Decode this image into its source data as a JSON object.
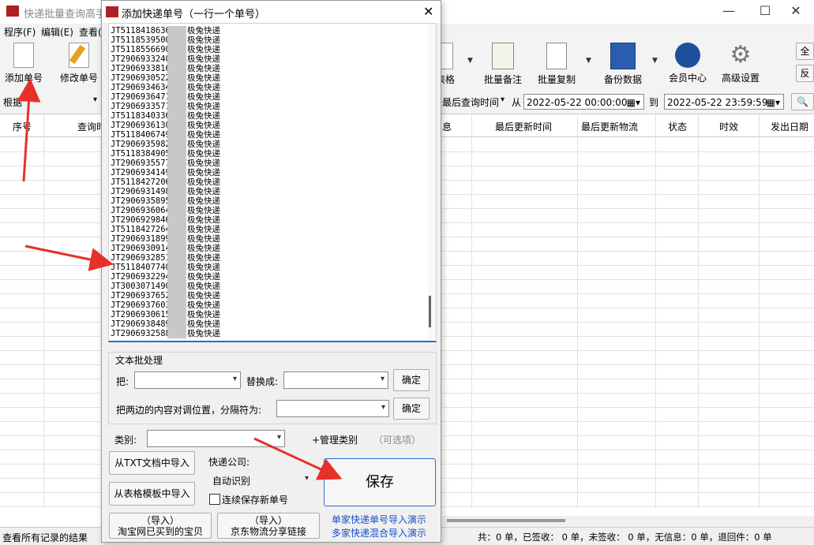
{
  "main": {
    "title": "快递批量查询高手",
    "menu": [
      "程序(F)",
      "编辑(E)",
      "查看("
    ],
    "toolbar_left": {
      "add": "添加单号",
      "edit": "修改单号"
    },
    "toolbar_right": {
      "table": "表格",
      "batch_note": "批量备注",
      "batch_copy": "批量复制",
      "backup": "备份数据",
      "member": "会员中心",
      "advanced": "高级设置",
      "select_all": "全选",
      "invert": "反选"
    },
    "filter": {
      "basis": "根据",
      "field": "最后查询时间",
      "from": "从",
      "start": "2022-05-22 00:00:00",
      "to": "到",
      "end": "2022-05-22 23:59:59"
    },
    "columns": [
      "序号",
      "查询时",
      "息",
      "最后更新时间",
      "最后更新物流",
      "状态",
      "时效",
      "发出日期"
    ],
    "status_left": "查看所有记录的结果",
    "status_right": "共：0 单，已签收： 0 单，未签收： 0 单，无信息：0 单，退回件：0 单"
  },
  "dialog": {
    "title": "添加快递单号（一行一个单号）",
    "close": "✕",
    "rows": [
      {
        "num": "JT51184186368",
        "carrier": "极兔快递"
      },
      {
        "num": "JT51185395000",
        "carrier": "极兔快递"
      },
      {
        "num": "JT51185566900",
        "carrier": "极兔快递"
      },
      {
        "num": "JT29069332400",
        "carrier": "极兔快递"
      },
      {
        "num": "JT29069338160",
        "carrier": "极兔快递"
      },
      {
        "num": "JT29069305220",
        "carrier": "极兔快递"
      },
      {
        "num": "JT29069346340",
        "carrier": "极兔快递"
      },
      {
        "num": "JT29069364710",
        "carrier": "极兔快递"
      },
      {
        "num": "JT29069335710",
        "carrier": "极兔快递"
      },
      {
        "num": "JT51183403360",
        "carrier": "极兔快递"
      },
      {
        "num": "JT29069361300",
        "carrier": "极兔快递"
      },
      {
        "num": "JT51184067490",
        "carrier": "极兔快递"
      },
      {
        "num": "JT29069359820",
        "carrier": "极兔快递"
      },
      {
        "num": "JT51183849050",
        "carrier": "极兔快递"
      },
      {
        "num": "JT29069355770",
        "carrier": "极兔快递"
      },
      {
        "num": "JT29069341490",
        "carrier": "极兔快递"
      },
      {
        "num": "JT51184272060",
        "carrier": "极兔快递"
      },
      {
        "num": "JT29069314980",
        "carrier": "极兔快递"
      },
      {
        "num": "JT29069358950",
        "carrier": "极兔快递"
      },
      {
        "num": "JT29069360640",
        "carrier": "极兔快递"
      },
      {
        "num": "JT29069298460",
        "carrier": "极兔快递"
      },
      {
        "num": "JT51184272640",
        "carrier": "极兔快递"
      },
      {
        "num": "JT29069318990",
        "carrier": "极兔快递"
      },
      {
        "num": "JT29069309140",
        "carrier": "极兔快递"
      },
      {
        "num": "JT29069328510",
        "carrier": "极兔快递"
      },
      {
        "num": "JT51184077400",
        "carrier": "极兔快递"
      },
      {
        "num": "JT29069322940",
        "carrier": "极兔快递"
      },
      {
        "num": "JT30030714900",
        "carrier": "极兔快递"
      },
      {
        "num": "JT29069376520",
        "carrier": "极兔快递"
      },
      {
        "num": "JT29069376030",
        "carrier": "极兔快递"
      },
      {
        "num": "JT29069306150",
        "carrier": "极兔快递"
      },
      {
        "num": "JT29069384890",
        "carrier": "极兔快递"
      },
      {
        "num": "JT29069325880",
        "carrier": "极兔快递"
      }
    ],
    "text_group": {
      "title": "文本批处理",
      "ba": "把:",
      "replace": "替换成:",
      "ok": "确定",
      "swap": "把两边的内容对调位置，分隔符为:",
      "ok2": "确定"
    },
    "category": {
      "label": "类别:",
      "manage": "+管理类别",
      "optional": "（可选项）"
    },
    "import_txt": "从TXT文档中导入",
    "import_table": "从表格模板中导入",
    "import_taobao_1": "（导入）",
    "import_taobao_2": "淘宝网已买到的宝贝",
    "import_jd_1": "（导入）",
    "import_jd_2": "京东物流分享链接",
    "company_label": "快递公司:",
    "company_value": "自动识别",
    "continuous_save": "连续保存新单号",
    "save": "保存",
    "link1": "单家快递单号导入演示",
    "link2": "多家快递混合导入演示"
  }
}
